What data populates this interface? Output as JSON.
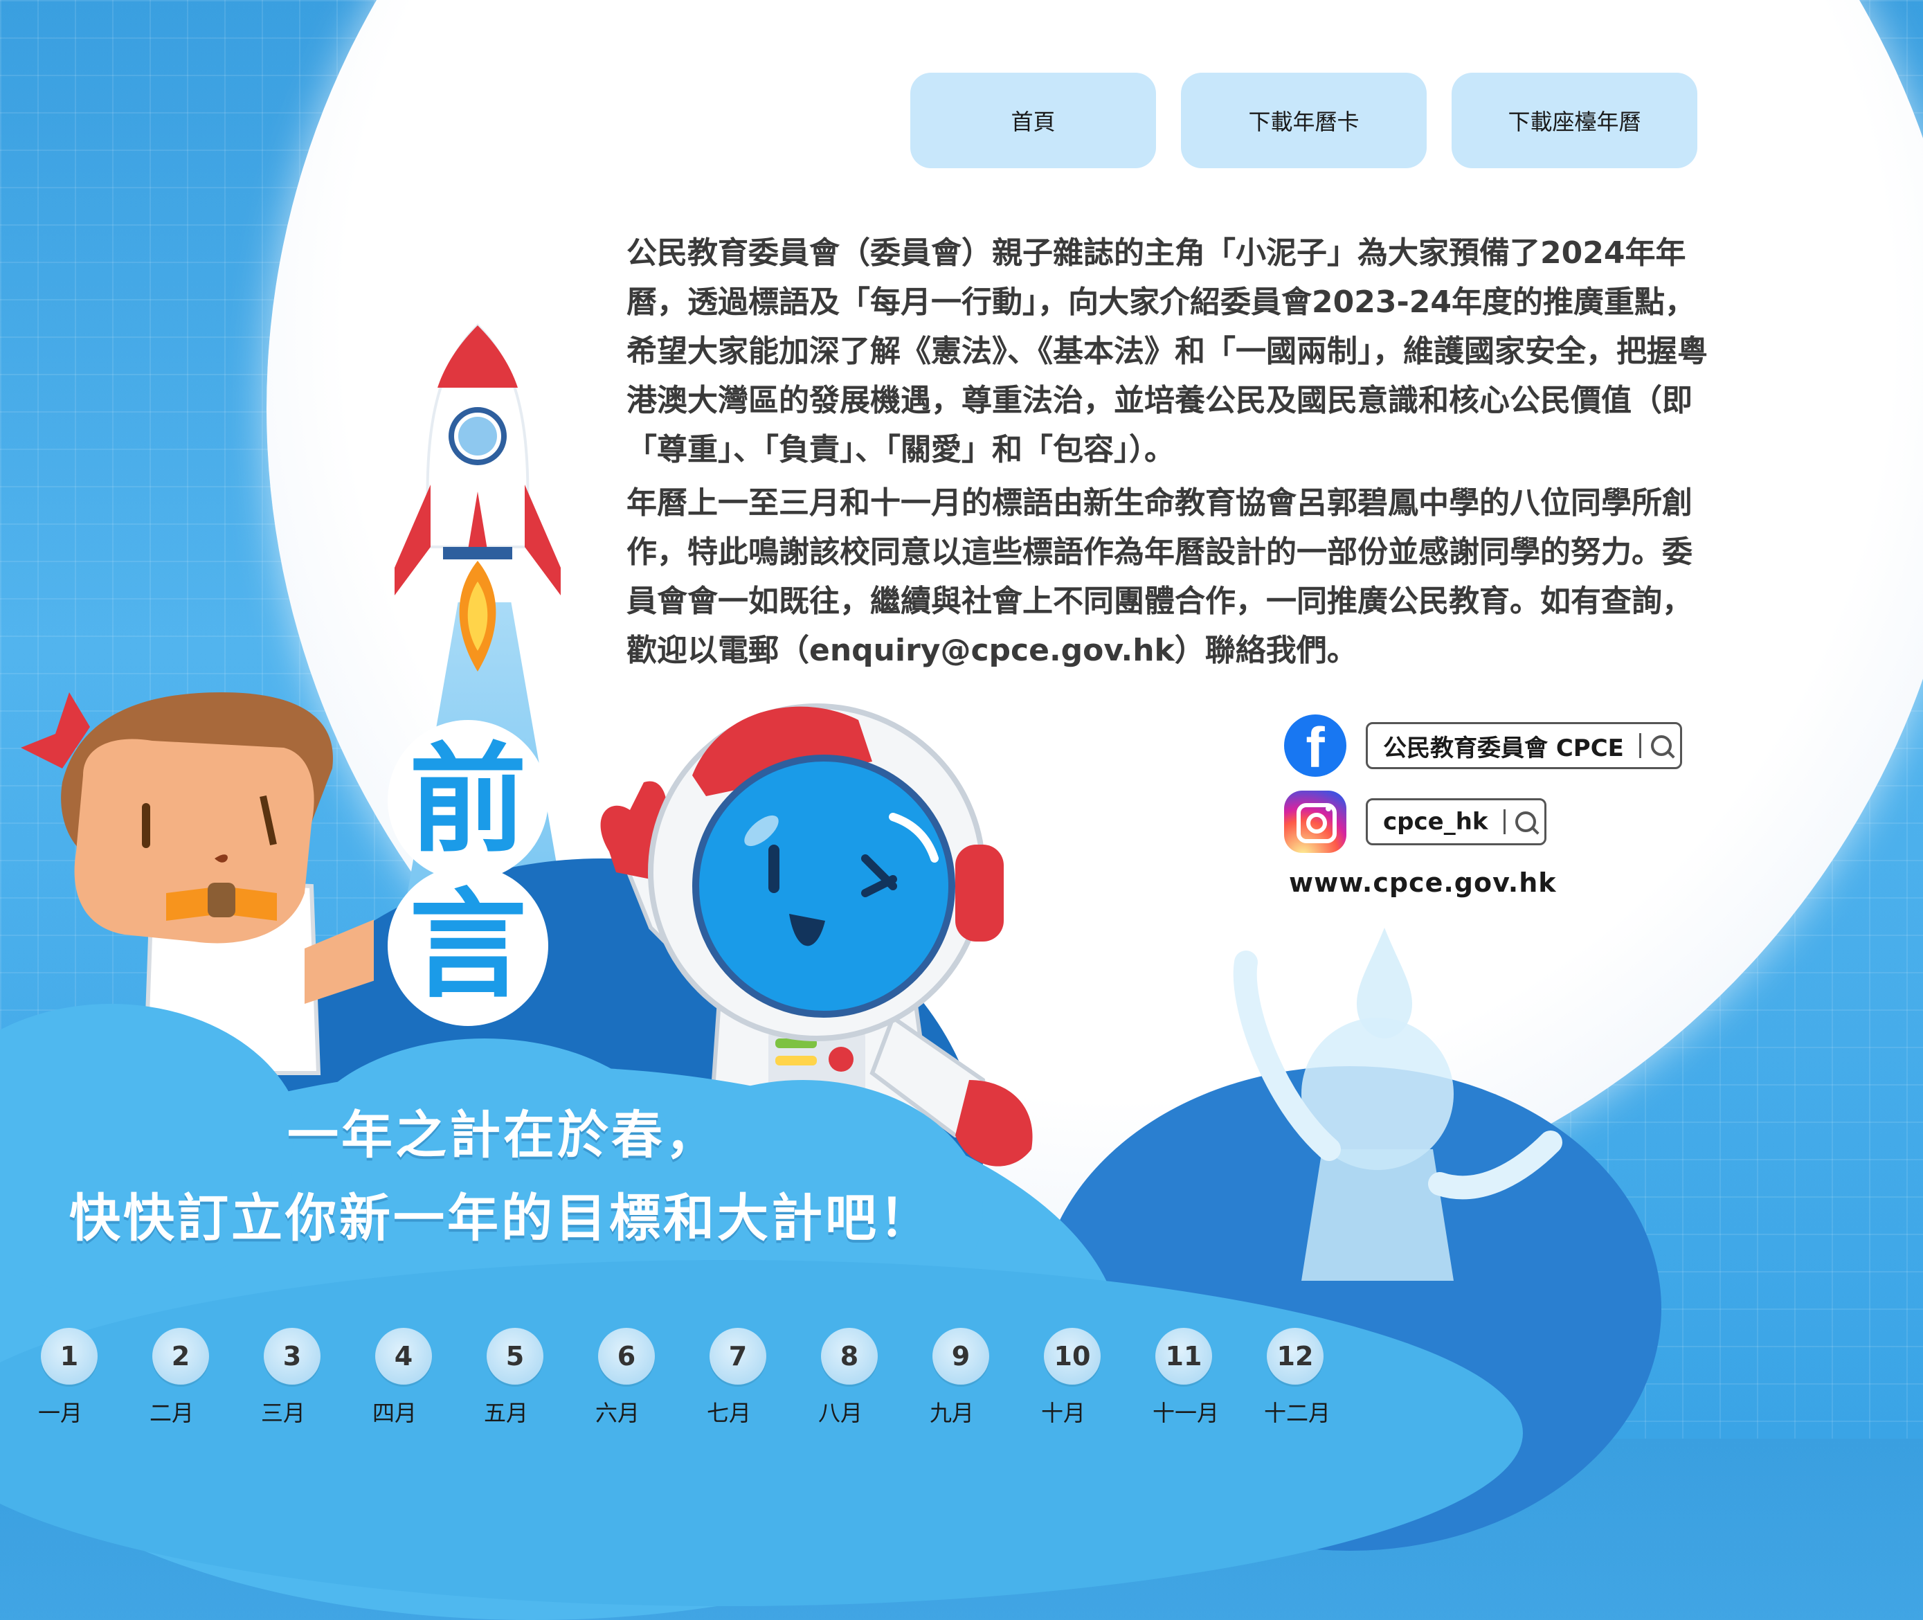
{
  "nav": {
    "home": "首頁",
    "download_card": "下載年曆卡",
    "download_desk": "下載座檯年曆"
  },
  "intro": {
    "paragraph1": "公民教育委員會（委員會）親子雜誌的主角「小泥子」為大家預備了2024年年曆，透過標語及「每月一行動」，向大家介紹委員會2023-24年度的推廣重點，希望大家能加深了解《憲法》、《基本法》和「一國兩制」，維護國家安全，把握粵港澳大灣區的發展機遇，尊重法治，並培養公民及國民意識和核心公民價值（即「尊重」、「負責」、「關愛」和「包容」）。",
    "paragraph2": "年曆上一至三月和十一月的標語由新生命教育協會呂郭碧鳳中學的八位同學所創作，特此鳴謝該校同意以這些標語作為年曆設計的一部份並感謝同學的努力。委員會會一如既往，繼續與社會上不同團體合作，一同推廣公民教育。如有查詢，歡迎以電郵（enquiry@cpce.gov.hk）聯絡我們。"
  },
  "social": {
    "facebook_label": "公民教育委員會 CPCE",
    "facebook_icon": "facebook-icon",
    "instagram_label": "cpce_hk",
    "instagram_icon": "instagram-icon",
    "website": "www.cpce.gov.hk"
  },
  "heading": {
    "char1": "前",
    "char2": "言"
  },
  "slogan": {
    "line1": "一年之計在於春，",
    "line2": "快快訂立你新一年的目標和大計吧！"
  },
  "months": [
    {
      "num": "1",
      "label": "一月"
    },
    {
      "num": "2",
      "label": "二月"
    },
    {
      "num": "3",
      "label": "三月"
    },
    {
      "num": "4",
      "label": "四月"
    },
    {
      "num": "5",
      "label": "五月"
    },
    {
      "num": "6",
      "label": "六月"
    },
    {
      "num": "7",
      "label": "七月"
    },
    {
      "num": "8",
      "label": "八月"
    },
    {
      "num": "9",
      "label": "九月"
    },
    {
      "num": "10",
      "label": "十月"
    },
    {
      "num": "11",
      "label": "十一月"
    },
    {
      "num": "12",
      "label": "十二月"
    }
  ],
  "colors": {
    "accent_blue": "#1b9be8",
    "nav_button": "#c8e7fb",
    "cloud": "#4fb8ef",
    "rocket_red": "#e0373f"
  }
}
